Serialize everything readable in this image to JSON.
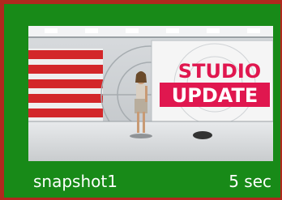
{
  "snapshot": {
    "name": "snapshot1",
    "duration": "5 sec",
    "thumbnail": {
      "sign_line1": "STUDIO",
      "sign_line2": "UPDATE"
    }
  },
  "colors": {
    "tile_background": "#188a18",
    "tile_border_selected": "#b0281e",
    "caption_text": "#ffffff",
    "sign_accent": "#e0174f"
  }
}
